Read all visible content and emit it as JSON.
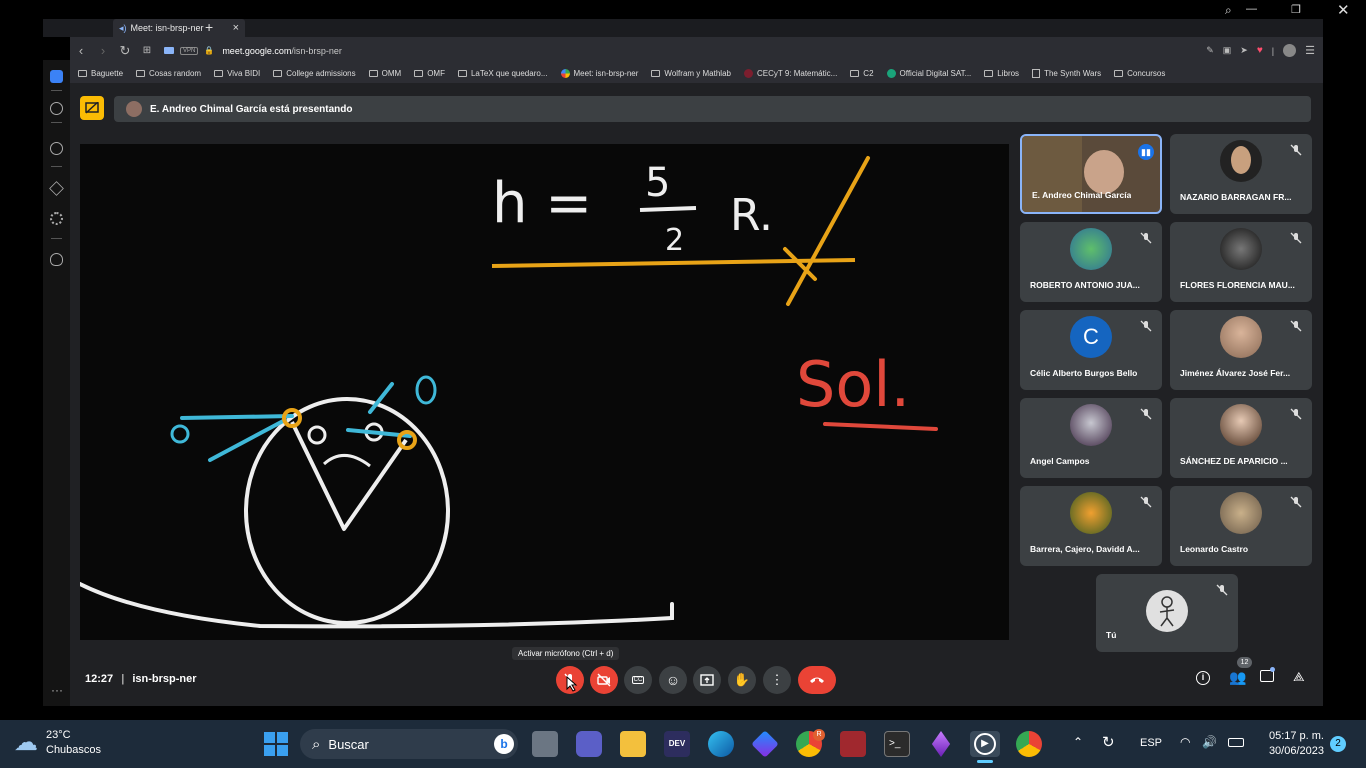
{
  "browser": {
    "tab_title": "Meet: isn-brsp-ner",
    "url_host": "meet.google.com",
    "url_path": "/isn-brsp-ner",
    "vpn_label": "VPN",
    "bookmarks": [
      "Baguette",
      "Cosas random",
      "Viva BIDI",
      "College admissions",
      "OMM",
      "OMF",
      "LaTeX que quedaro...",
      "Meet: isn-brsp-ner",
      "Wolfram y Mathlab",
      "CECyT 9: Matemátic...",
      "C2",
      "Official Digital SAT...",
      "Libros",
      "The Synth Wars",
      "Concursos"
    ]
  },
  "meet": {
    "presenting_banner": "E. Andreo Chimal García está presentando",
    "whiteboard": {
      "formula_text": "h = ",
      "fraction_num": "5",
      "fraction_den": "2",
      "formula_tail": "R.",
      "solution_word": "Sol."
    },
    "participants": [
      {
        "name": "E. Andreo Chimal García"
      },
      {
        "name": "NAZARIO BARRAGAN FR..."
      },
      {
        "name": "ROBERTO ANTONIO JUA..."
      },
      {
        "name": "FLORES FLORENCIA MAU..."
      },
      {
        "name": "Célic Alberto Burgos Bello",
        "initial": "C"
      },
      {
        "name": "Jiménez Álvarez José Fer..."
      },
      {
        "name": "Angel Campos"
      },
      {
        "name": "SÁNCHEZ DE APARICIO ..."
      },
      {
        "name": "Barrera, Cajero, Davidd A..."
      },
      {
        "name": "Leonardo Castro"
      },
      {
        "name": "Tú"
      }
    ],
    "time": "12:27",
    "separator": "|",
    "meeting_code": "isn-brsp-ner",
    "tooltip": "Activar micrófono (Ctrl + d)",
    "people_count": "12"
  },
  "taskbar": {
    "temperature": "23°C",
    "weather": "Chubascos",
    "search_placeholder": "Buscar",
    "language": "ESP",
    "time": "05:17 p. m.",
    "date": "30/06/2023",
    "notifications": "2",
    "chrome_badge": "R"
  },
  "colors": {
    "meet_bg": "#202124",
    "tile_bg": "#3c4043",
    "end_call": "#ea4335",
    "yellow": "#fbbc04",
    "taskbar": "#1d2b3a"
  }
}
